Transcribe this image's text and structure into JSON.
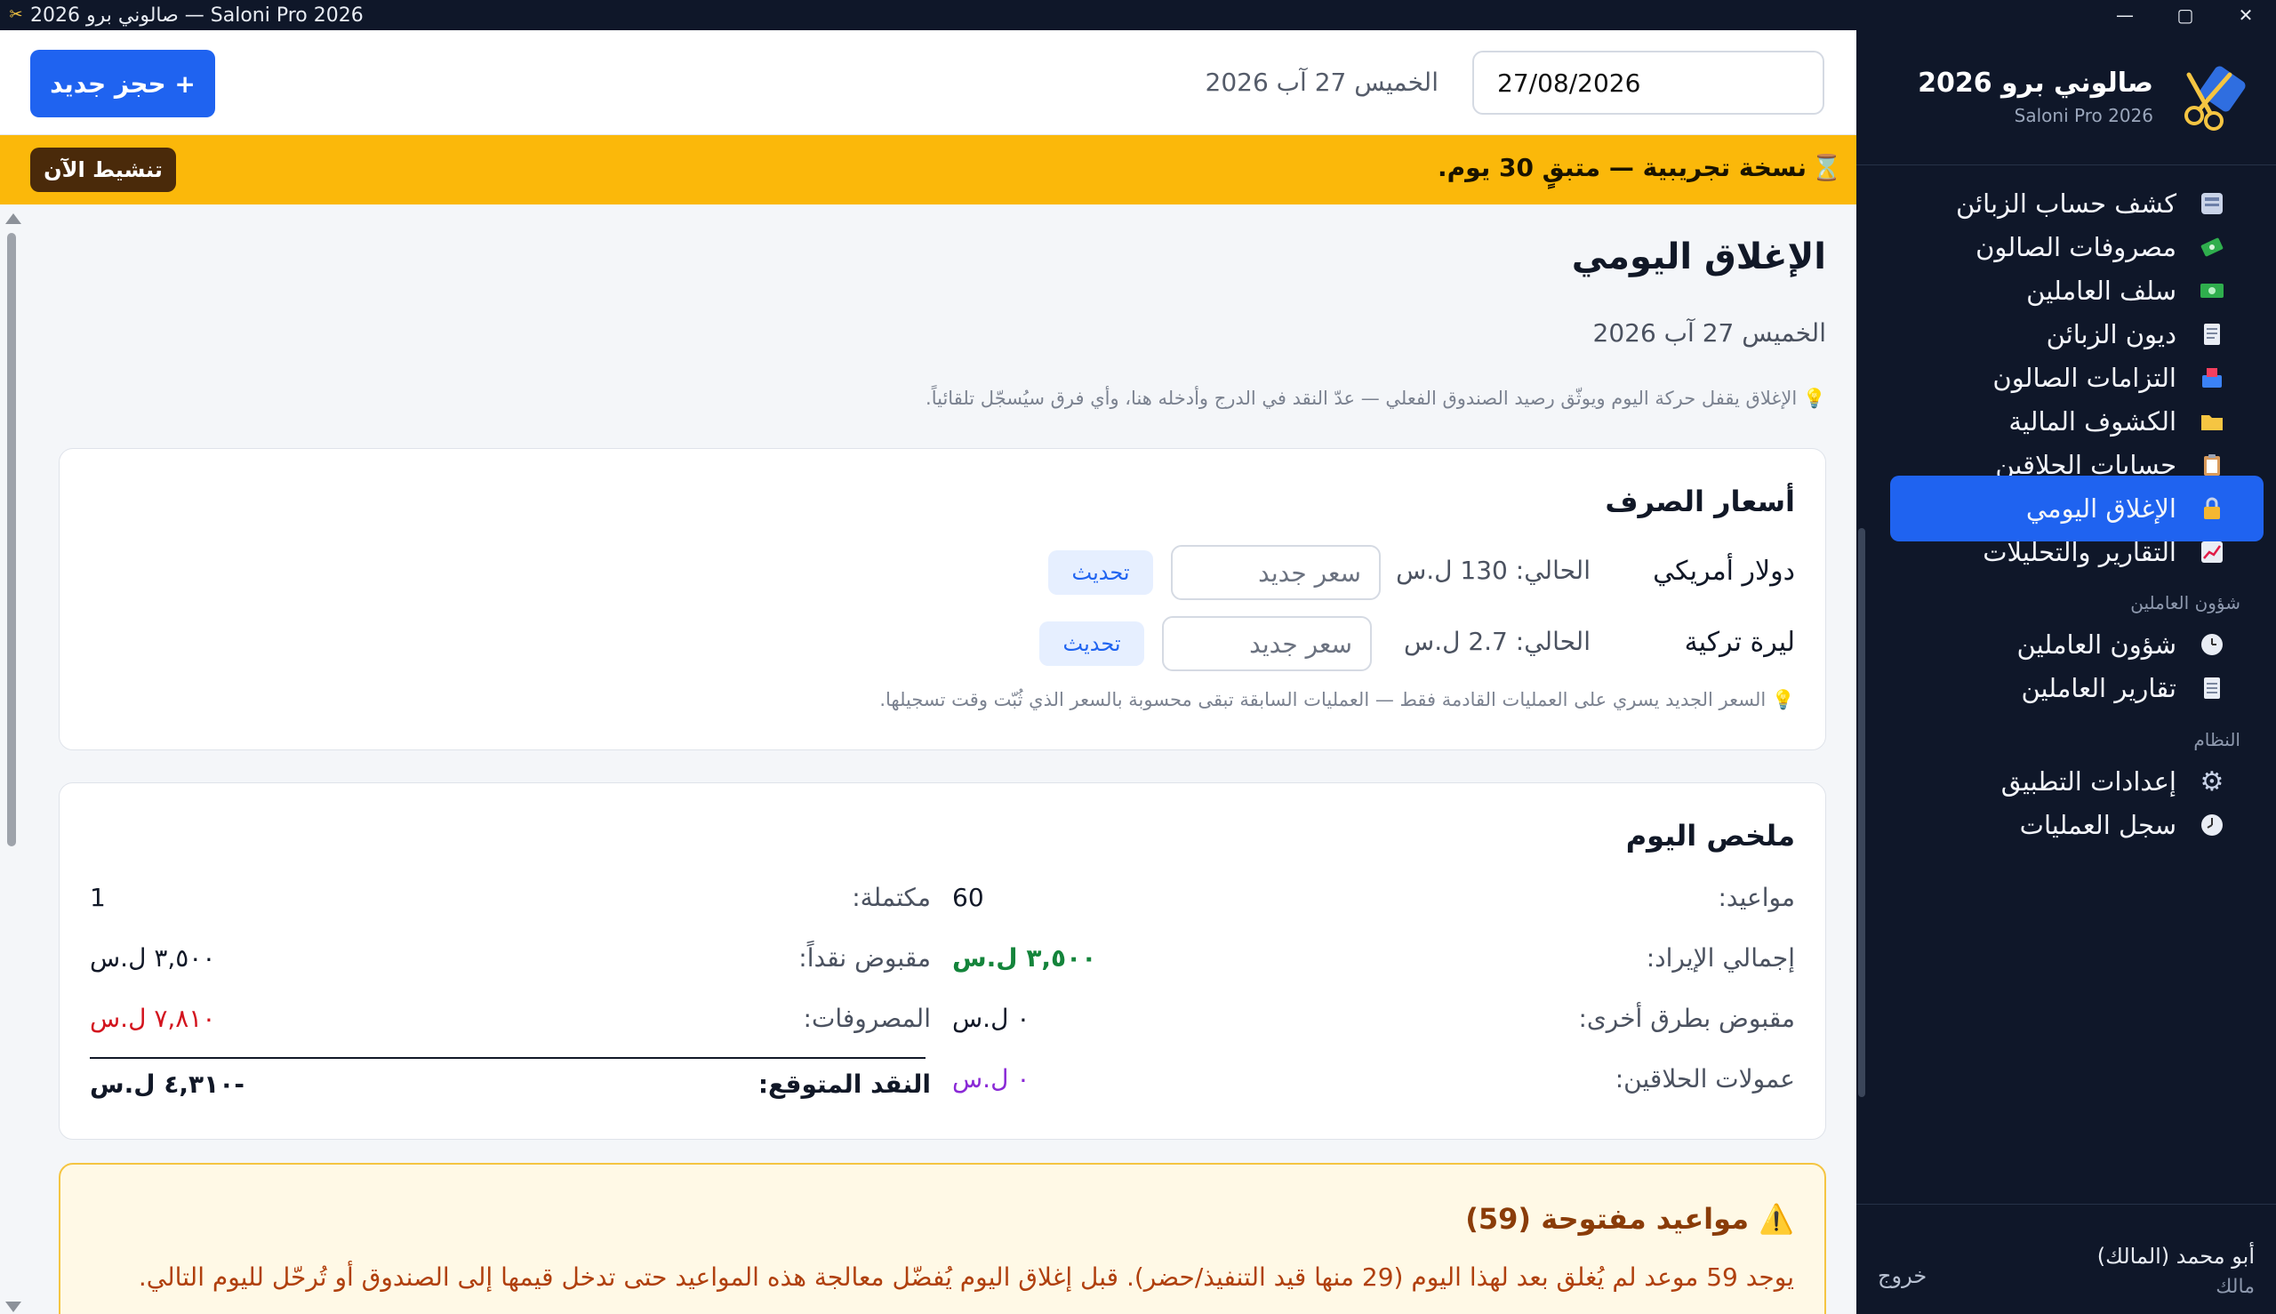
{
  "window": {
    "title": "صالوني برو 2026 — Saloni Pro 2026",
    "minimize": "—",
    "maximize": "▢",
    "close": "✕"
  },
  "brand": {
    "name": "صالوني برو 2026",
    "subtitle": "Saloni Pro 2026"
  },
  "sidebar": {
    "items": [
      {
        "label": "كشف حساب الزبائن",
        "icon": "customer-statement-icon"
      },
      {
        "label": "مصروفات الصالون",
        "icon": "money-expenses-icon"
      },
      {
        "label": "سلف العاملين",
        "icon": "cash-advance-icon"
      },
      {
        "label": "ديون الزبائن",
        "icon": "receipt-icon"
      },
      {
        "label": "التزامات الصالون",
        "icon": "inbox-tray-icon"
      },
      {
        "label": "الكشوف المالية",
        "icon": "folder-icon"
      },
      {
        "label": "حسابات الحلاقين",
        "icon": "clipboard-icon"
      },
      {
        "label": "الإغلاق اليومي",
        "icon": "lock-icon",
        "active": true
      },
      {
        "label": "التقارير والتحليلات",
        "icon": "chart-increasing-icon"
      }
    ],
    "section_staff": "شؤون العاملين",
    "staff_items": [
      {
        "label": "شؤون العاملين",
        "icon": "clock-icon"
      },
      {
        "label": "تقارير العاملين",
        "icon": "notepad-icon"
      }
    ],
    "section_system": "النظام",
    "system_items": [
      {
        "label": "إعدادات التطبيق",
        "icon": "gear-icon"
      },
      {
        "label": "سجل العمليات",
        "icon": "clock-history-icon"
      }
    ],
    "user": {
      "name": "أبو محمد (المالك)",
      "role": "مالك",
      "logout": "خروج"
    }
  },
  "header": {
    "date_value": "27/08/2026",
    "date_text": "الخميس 27 آب 2026",
    "new_booking": "+ حجز جديد"
  },
  "trial": {
    "text": "نسخة تجريبية — متبقٍ 30 يوم.",
    "icon": "⌛",
    "activate": "تنشيط الآن"
  },
  "page": {
    "title": "الإغلاق اليومي",
    "date": "الخميس 27 آب 2026",
    "hint": "💡 الإغلاق يقفل حركة اليوم ويوثّق رصيد الصندوق الفعلي — عدّ النقد في الدرج وأدخله هنا، وأي فرق سيُسجّل تلقائياً."
  },
  "rates": {
    "title": "أسعار الصرف",
    "rows": [
      {
        "name": "دولار أمريكي",
        "current": "الحالي: 130 ل.س",
        "placeholder": "سعر جديد",
        "button": "تحديث"
      },
      {
        "name": "ليرة تركية",
        "current": "الحالي: 2.7 ل.س",
        "placeholder": "سعر جديد",
        "button": "تحديث"
      }
    ],
    "hint": "💡 السعر الجديد يسري على العمليات القادمة فقط — العمليات السابقة تبقى محسوبة بالسعر الذي ثُبّت وقت تسجيلها."
  },
  "summary": {
    "title": "ملخص اليوم",
    "appointments_label": "مواعيد:",
    "appointments": "60",
    "completed_label": "مكتملة:",
    "completed": "1",
    "revenue_label": "إجمالي الإيراد:",
    "revenue": "٣,٥٠٠ ل.س",
    "cash_label": "مقبوض نقداً:",
    "cash": "٣,٥٠٠ ل.س",
    "other_label": "مقبوض بطرق أخرى:",
    "other": "٠ ل.س",
    "expenses_label": "المصروفات:",
    "expenses": "٧,٨١٠ ل.س",
    "commissions_label": "عمولات الحلاقين:",
    "commissions": "٠ ل.س",
    "expected_label": "النقد المتوقع:",
    "expected": "-٤,٣١٠ ل.س"
  },
  "warning": {
    "title": "⚠️ مواعيد مفتوحة (59)",
    "text": "يوجد 59 موعد لم يُغلق بعد لهذا اليوم (29 منها قيد التنفيذ/حضر). قبل إغلاق اليوم يُفضّل معالجة هذه المواعيد حتى تدخل قيمها إلى الصندوق أو تُرحّل لليوم التالي."
  },
  "colors": {
    "accent": "#1f63f0",
    "sidebar": "#0f1729",
    "trial": "#fbb80a",
    "positive": "#14843b",
    "negative": "#d3141e",
    "commission": "#8a2ad6"
  }
}
